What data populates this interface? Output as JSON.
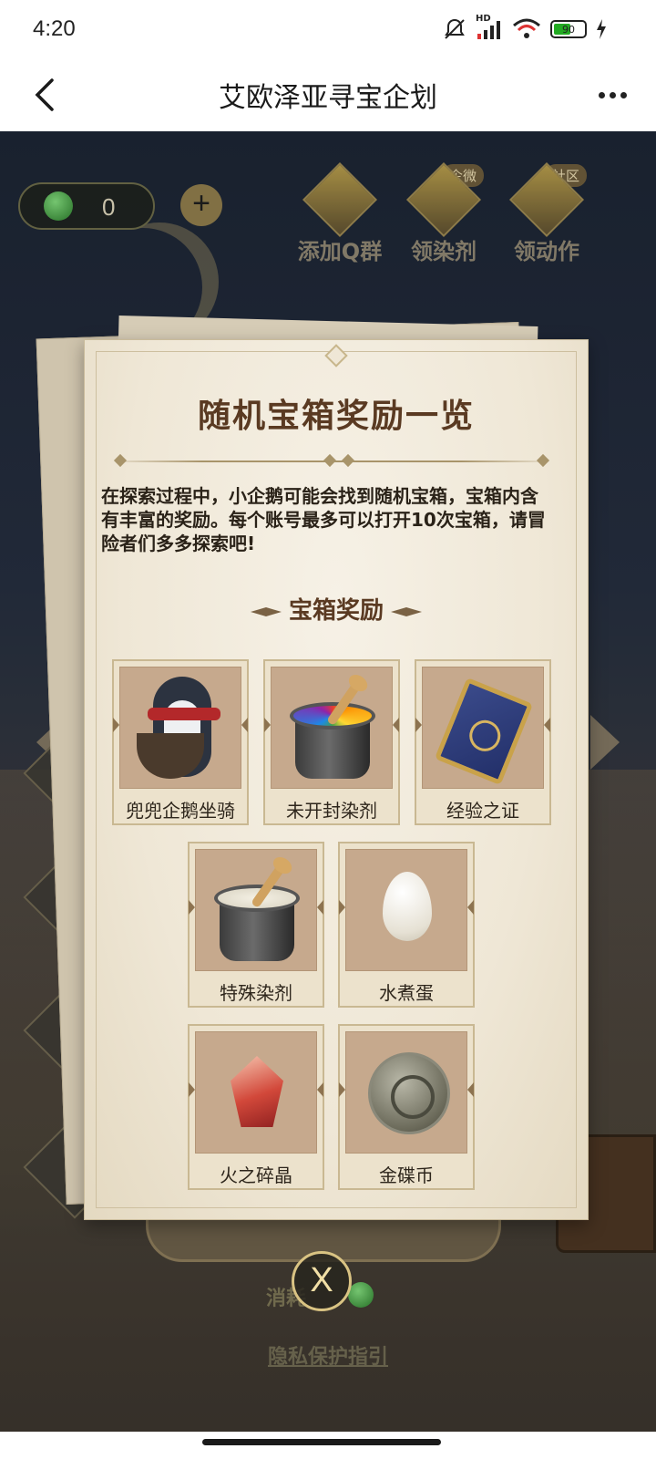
{
  "status_bar": {
    "time": "4:20",
    "network_badge": "HD",
    "battery_level": "90",
    "icons": [
      "mute-bell-icon",
      "signal-icon",
      "wifi-icon",
      "battery-icon",
      "charging-icon"
    ]
  },
  "header": {
    "title": "艾欧泽亚寻宝企划",
    "back_icon": "chevron-left-icon",
    "more_icon": "more-dots-icon"
  },
  "game": {
    "coin_count": "0",
    "plus_label": "+",
    "actions": [
      {
        "label": "添加Q群",
        "tag": ""
      },
      {
        "label": "领染剂",
        "tag": "企微"
      },
      {
        "label": "领动作",
        "tag": "社区"
      }
    ],
    "consume_label": "消耗",
    "privacy_link": "隐私保护指引"
  },
  "modal": {
    "title": "随机宝箱奖励一览",
    "intro": "在探索过程中，小企鹅可能会找到随机宝箱，宝箱内含有丰富的奖励。每个账号最多可以打开10次宝箱，请冒险者们多多探索吧!",
    "section_title": "宝箱奖励",
    "rewards": [
      {
        "name": "兜兜企鹅坐骑",
        "icon": "penguin-mount-icon"
      },
      {
        "name": "未开封染剂",
        "icon": "rainbow-dye-bucket-icon"
      },
      {
        "name": "经验之证",
        "icon": "experience-card-icon"
      },
      {
        "name": "特殊染剂",
        "icon": "white-dye-bucket-icon"
      },
      {
        "name": "水煮蛋",
        "icon": "boiled-egg-icon"
      },
      {
        "name": "火之碎晶",
        "icon": "fire-shard-icon"
      },
      {
        "name": "金碟币",
        "icon": "gold-saucer-coin-icon"
      }
    ],
    "close_label": "X"
  },
  "colors": {
    "title_brown": "#5a3a22",
    "paper": "#efe7d6",
    "item_bg": "#c6a98d",
    "close_gold": "#d9c383"
  }
}
